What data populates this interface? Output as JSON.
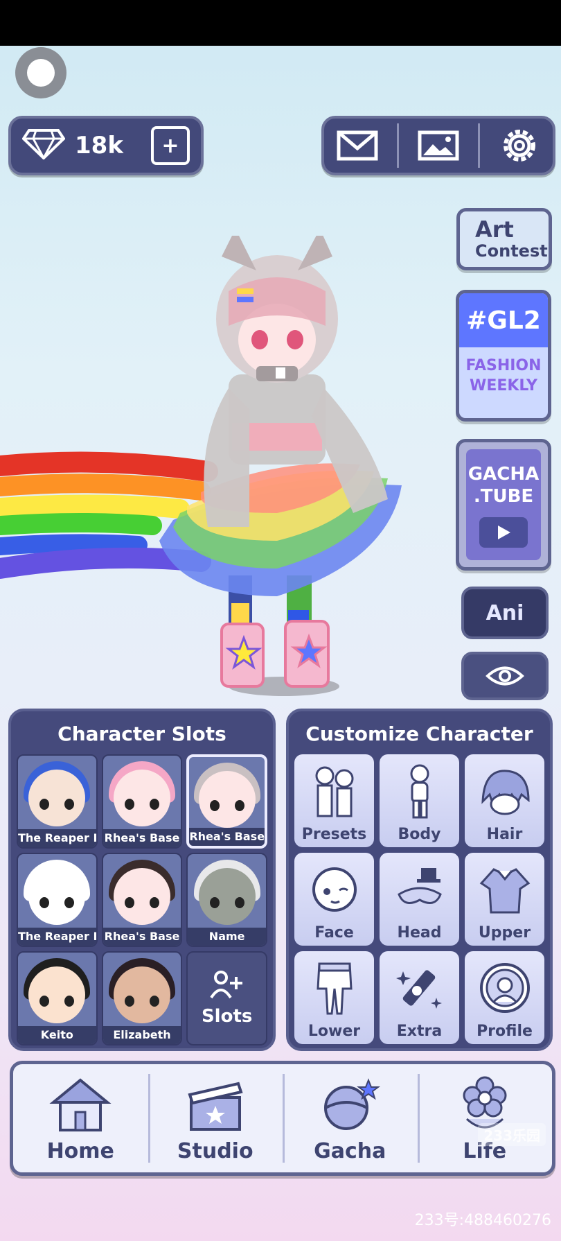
{
  "currency": {
    "gems": "18k"
  },
  "side_buttons": {
    "art_contest_line1": "Art",
    "art_contest_line2": "Contest",
    "gl2_tag": "#GL2",
    "gl2_line1": "FASHION",
    "gl2_line2": "WEEKLY",
    "gacha_tube_line1": "GACHA",
    "gacha_tube_line2": ".TUBE",
    "ani_label": "Ani"
  },
  "character_slots": {
    "title": "Character Slots",
    "slots": [
      {
        "label": "The Reaper Bo",
        "hair": "#3a62d8",
        "skin": "#f7e3d6"
      },
      {
        "label": "Rhea's Base",
        "hair": "#f5a7c6",
        "skin": "#fde6e6"
      },
      {
        "label": "Rhea's Base",
        "hair": "#c9c0c2",
        "skin": "#fde6e6"
      },
      {
        "label": "The Reaper Bo",
        "hair": "#ffffff",
        "skin": "#ffffff"
      },
      {
        "label": "Rhea's Base",
        "hair": "#3a2c2c",
        "skin": "#fde6e6"
      },
      {
        "label": "Name",
        "hair": "#e8e8ea",
        "skin": "#9aa097"
      },
      {
        "label": "Keito",
        "hair": "#1f1f1f",
        "skin": "#fbe2cf"
      },
      {
        "label": "Elizabeth",
        "hair": "#2a1f25",
        "skin": "#e2b89f"
      }
    ],
    "add_label": "Slots"
  },
  "customize": {
    "title": "Customize Character",
    "buttons": [
      "Presets",
      "Body",
      "Hair",
      "Face",
      "Head",
      "Upper",
      "Lower",
      "Extra",
      "Profile"
    ]
  },
  "nav": {
    "tabs": [
      "Home",
      "Studio",
      "Gacha",
      "Life"
    ]
  },
  "watermark": {
    "logo": "233乐园",
    "id_text": "233号:488460276"
  },
  "colors": {
    "panel": "#454a7c",
    "accent_blue": "#5e76ff",
    "accent_purple": "#8a64e8"
  }
}
